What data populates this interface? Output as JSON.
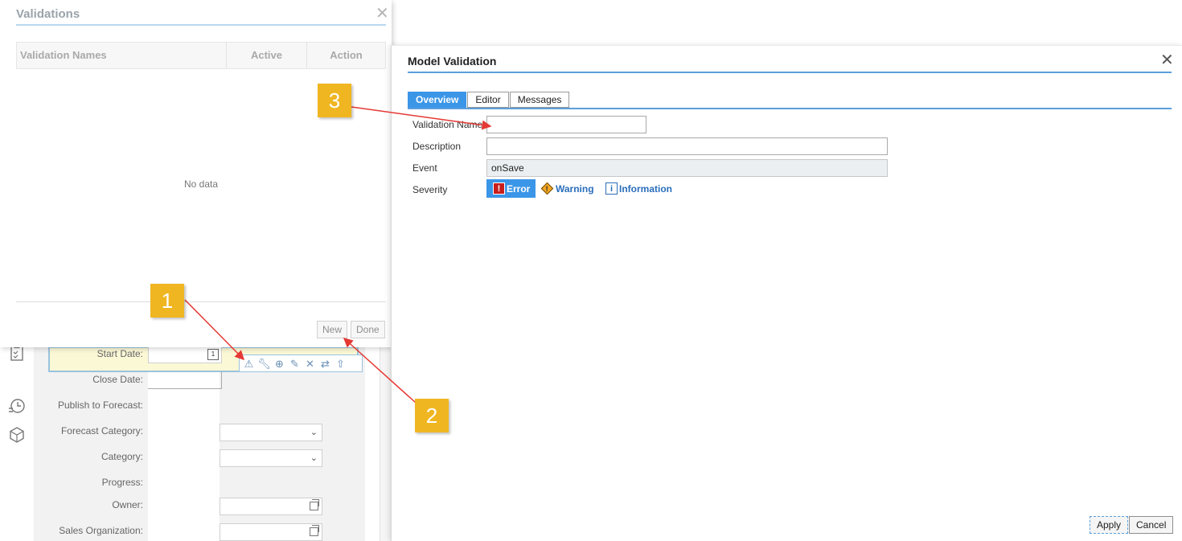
{
  "background_form": {
    "labels": {
      "start_date": "Start Date:",
      "close_date": "Close Date:",
      "publish_to_forecast": "Publish to Forecast:",
      "forecast_category": "Forecast Category:",
      "category": "Category:",
      "progress": "Progress:",
      "owner": "Owner:",
      "sales_organization": "Sales Organization:"
    },
    "calendar_day": "1"
  },
  "validations_dialog": {
    "title": "Validations",
    "columns": [
      "Validation Names",
      "Active",
      "Action"
    ],
    "empty_text": "No data",
    "buttons": {
      "new": "New",
      "done": "Done"
    }
  },
  "model_validation": {
    "title": "Model Validation",
    "tabs": [
      {
        "label": "Overview",
        "active": true
      },
      {
        "label": "Editor",
        "active": false
      },
      {
        "label": "Messages",
        "active": false
      }
    ],
    "fields": {
      "validation_name": {
        "label": "Validation Name",
        "value": ""
      },
      "description": {
        "label": "Description",
        "value": ""
      },
      "event": {
        "label": "Event",
        "value": "onSave"
      },
      "severity": {
        "label": "Severity",
        "options": [
          {
            "label": "Error",
            "icon": "error-icon",
            "selected": true
          },
          {
            "label": "Warning",
            "icon": "warning-icon",
            "selected": false
          },
          {
            "label": "Information",
            "icon": "info-icon",
            "selected": false
          }
        ]
      }
    },
    "buttons": {
      "apply": "Apply",
      "cancel": "Cancel"
    }
  },
  "callouts": [
    "1",
    "2",
    "3"
  ],
  "colors": {
    "accent": "#3b96e8",
    "callout": "#f0b622",
    "arrow": "#e53935",
    "error": "#c81e1e"
  }
}
